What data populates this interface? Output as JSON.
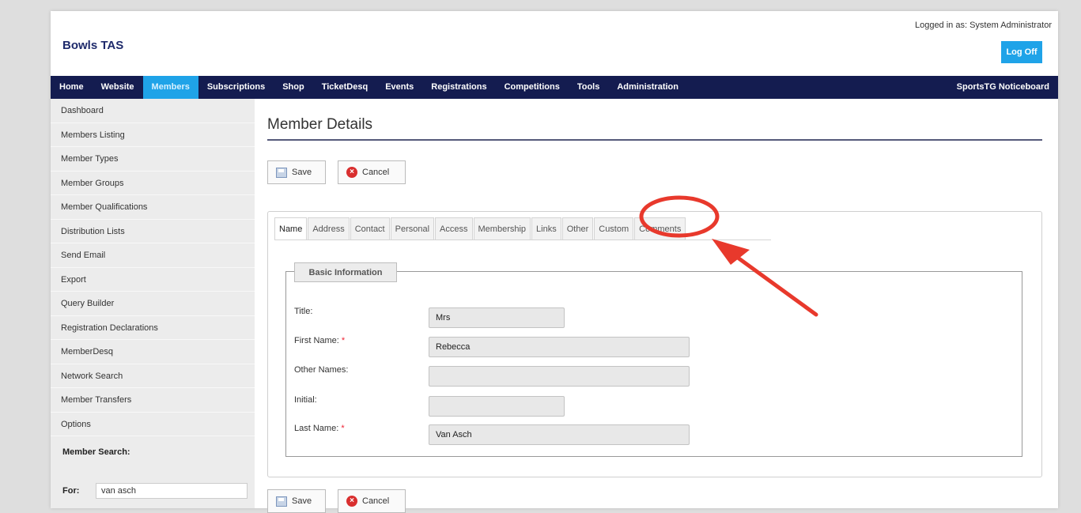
{
  "header": {
    "brand": "Bowls TAS",
    "logged_in": "Logged in as: System Administrator",
    "log_off": "Log Off"
  },
  "nav": {
    "items": [
      "Home",
      "Website",
      "Members",
      "Subscriptions",
      "Shop",
      "TicketDesq",
      "Events",
      "Registrations",
      "Competitions",
      "Tools",
      "Administration"
    ],
    "active": "Members",
    "right": "SportsTG Noticeboard"
  },
  "sidebar": {
    "items": [
      "Dashboard",
      "Members Listing",
      "Member Types",
      "Member Groups",
      "Member Qualifications",
      "Distribution Lists",
      "Send Email",
      "Export",
      "Query Builder",
      "Registration Declarations",
      "MemberDesq",
      "Network Search",
      "Member Transfers",
      "Options"
    ],
    "search_title": "Member Search:",
    "search_for_label": "For:",
    "search_value": "van asch"
  },
  "main": {
    "title": "Member Details",
    "save_label": "Save",
    "cancel_label": "Cancel",
    "tabs": [
      "Name",
      "Address",
      "Contact",
      "Personal",
      "Access",
      "Membership",
      "Links",
      "Other",
      "Custom",
      "Comments"
    ],
    "active_tab": "Name",
    "highlighted_tab": "Custom",
    "fieldset_legend": "Basic Information",
    "fields": {
      "title": {
        "label": "Title:",
        "value": "Mrs"
      },
      "first_name": {
        "label": "First Name:",
        "value": "Rebecca",
        "required_mark": "*"
      },
      "other_names": {
        "label": "Other Names:",
        "value": ""
      },
      "initial": {
        "label": "Initial:",
        "value": ""
      },
      "last_name": {
        "label": "Last Name:",
        "value": "Van Asch",
        "required_mark": "*"
      }
    }
  },
  "colors": {
    "nav_bg": "#141c50",
    "accent": "#1fa3e8",
    "annotation": "#e8392c"
  }
}
